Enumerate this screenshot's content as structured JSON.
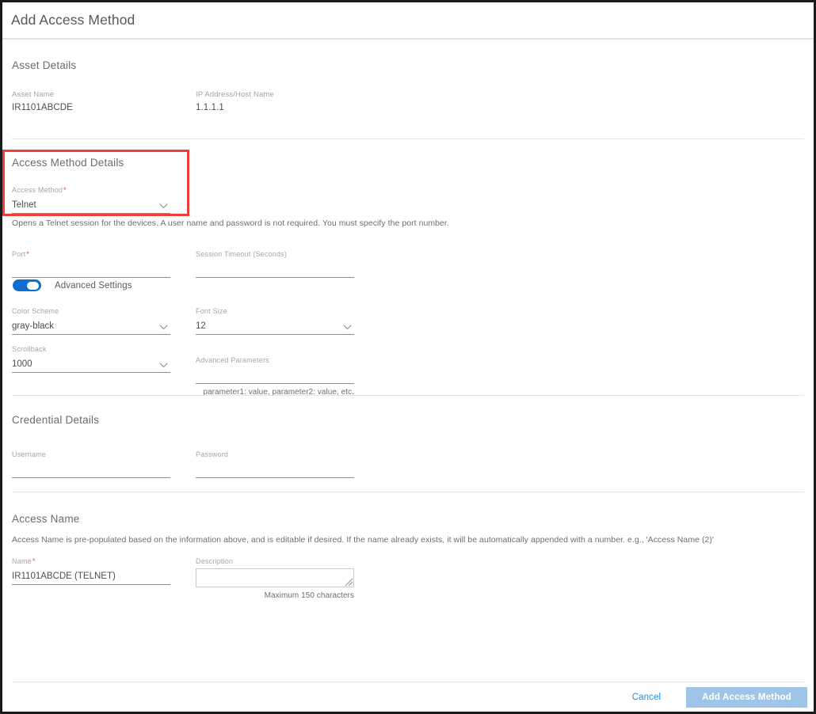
{
  "dialog": {
    "title": "Add Access Method"
  },
  "asset_details": {
    "section_title": "Asset Details",
    "fields": [
      {
        "label": "Asset Name",
        "value": "IR1101ABCDE"
      },
      {
        "label": "IP Address/Host Name",
        "value": "1.1.1.1"
      }
    ]
  },
  "access_method_details": {
    "section_title": "Access Method Details",
    "access_method": {
      "label": "Access Method",
      "required_marker": "*",
      "value": "Telnet",
      "icon": "chevron-down-icon"
    },
    "help_text": "Opens a Telnet session for the devices. A user name and password is not required. You must specify the port number.",
    "port": {
      "label": "Port",
      "required_marker": "*",
      "value": "",
      "placeholder": ""
    },
    "session_timeout": {
      "label": "Session Timeout (Seconds)",
      "value": "",
      "placeholder": ""
    },
    "advanced_toggle": {
      "label": "Advanced Settings",
      "state": "on",
      "color": "#0f6fd1"
    },
    "color_scheme": {
      "label": "Color Scheme",
      "value": "gray-black",
      "icon": "chevron-down-icon"
    },
    "font_size": {
      "label": "Font Size",
      "value": "12",
      "icon": "chevron-down-icon"
    },
    "scrollback": {
      "label": "Scrollback",
      "value": "1000",
      "icon": "chevron-down-icon"
    },
    "advanced_parameters": {
      "label": "Advanced Parameters",
      "value": "",
      "hint": "parameter1: value, parameter2: value, etc."
    }
  },
  "credential_details": {
    "section_title": "Credential Details",
    "username": {
      "label": "Username",
      "value": ""
    },
    "password": {
      "label": "Password",
      "value": ""
    }
  },
  "access_name": {
    "section_title": "Access Name",
    "description_text": "Access Name is pre-populated based on the information above, and is editable if desired. If the name already exists, it will be automatically appended with a number. e.g., 'Access Name (2)'",
    "name": {
      "label": "Name",
      "required_marker": "*",
      "value": "IR1101ABCDE (TELNET)"
    },
    "description": {
      "label": "Description",
      "value": "",
      "hint": "Maximum 150 characters"
    }
  },
  "footer": {
    "cancel_label": "Cancel",
    "submit_label": "Add Access Method",
    "submit_disabled_color": "#9ec5e8",
    "cancel_link_color": "#1f8fe0"
  },
  "annotation": {
    "highlight_color": "#ef3e3a",
    "target": "access-method-details-section"
  }
}
